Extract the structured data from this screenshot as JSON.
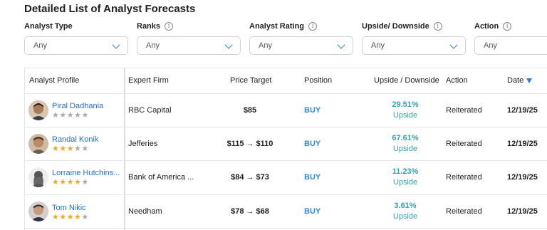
{
  "page_title": "Detailed List of Analyst Forecasts",
  "filters": [
    {
      "label": "Analyst Type",
      "value": "Any",
      "has_info": false
    },
    {
      "label": "Ranks",
      "value": "Any",
      "has_info": true
    },
    {
      "label": "Analyst Rating",
      "value": "Any",
      "has_info": true
    },
    {
      "label": "Upside/ Downside",
      "value": "Any",
      "has_info": true
    },
    {
      "label": "Action",
      "value": "Any",
      "has_info": true
    }
  ],
  "info_glyph": "i",
  "table": {
    "headers": {
      "profile": "Analyst Profile",
      "firm": "Expert Firm",
      "price": "Price Target",
      "position": "Position",
      "upside": "Upside / Downside",
      "action": "Action",
      "date": "Date"
    },
    "rows": [
      {
        "name": "Piral Dadhania",
        "stars": 0,
        "firm": "RBC Capital",
        "price": "$85",
        "position": "BUY",
        "upside_pct": "29.51%",
        "upside_label": "Upside",
        "action": "Reiterated",
        "date": "12/19/25",
        "avatar": "man-dark-hair"
      },
      {
        "name": "Randal Konik",
        "stars": 3,
        "firm": "Jefferies",
        "price": "$115 → $110",
        "position": "BUY",
        "upside_pct": "67.61%",
        "upside_label": "Upside",
        "action": "Reiterated",
        "date": "12/19/25",
        "avatar": "man-smiling"
      },
      {
        "name": "Lorraine Hutchins...",
        "stars": 4,
        "firm": "Bank of America ...",
        "price": "$84 → $73",
        "position": "BUY",
        "upside_pct": "11.23%",
        "upside_label": "Upside",
        "action": "Reiterated",
        "date": "12/19/25",
        "avatar": "silhouette"
      },
      {
        "name": "Tom Nikic",
        "stars": 4,
        "firm": "Needham",
        "price": "$78 → $68",
        "position": "BUY",
        "upside_pct": "3.61%",
        "upside_label": "Upside",
        "action": "Reiterated",
        "date": "12/19/25",
        "avatar": "man-short-hair"
      }
    ]
  },
  "colors": {
    "link": "#1e73c9",
    "buy": "#2f8bd6",
    "upside": "#33a4ad",
    "star": "#f5a623",
    "star_empty": "#a7a9ac",
    "accent": "#2980d9"
  }
}
